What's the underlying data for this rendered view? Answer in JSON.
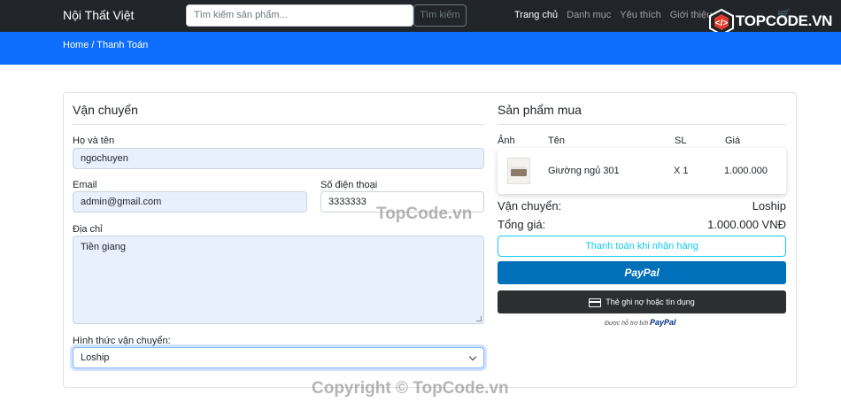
{
  "nav": {
    "brand": "Nội Thất Việt",
    "search_placeholder": "Tìm kiếm sản phẩm...",
    "search_button": "Tìm kiếm",
    "links": [
      "Trang chủ",
      "Danh mục",
      "Yêu thích",
      "Giới thiệu"
    ],
    "logo_text": "TOPCODE.VN"
  },
  "breadcrumb": "Home / Thanh Toán",
  "shipping": {
    "title": "Vận chuyển",
    "name_label": "Họ và tên",
    "name_value": "ngochuyen",
    "email_label": "Email",
    "email_value": "admin@gmail.com",
    "phone_label": "Số điện thoại",
    "phone_value": "3333333",
    "address_label": "Địa chỉ",
    "address_value": "Tiền giang",
    "method_label": "Hình thức vận chuyển:",
    "method_value": "Loship"
  },
  "order": {
    "title": "Sản phẩm mua",
    "headers": [
      "Ảnh",
      "Tên",
      "SL",
      "Giá"
    ],
    "items": [
      {
        "name": "Giường ngủ 301",
        "qty": "X 1",
        "price": "1.000.000"
      }
    ],
    "shipping_label": "Vận chuyển:",
    "shipping_value": "Loship",
    "total_label": "Tổng giá:",
    "total_value": "1.000.000 VNĐ",
    "cod_button": "Thanh toán khi nhận hàng",
    "paypal_button": "PayPal",
    "card_button": "Thẻ ghi nợ hoặc tín dụng",
    "powered_prefix": "Được hỗ trợ bởi",
    "powered_brand": "PayPal"
  },
  "watermarks": [
    "TopCode.vn",
    "Copyright © TopCode.vn"
  ],
  "colors": {
    "navbar": "#212529",
    "banner": "#0d6efd",
    "paypal": "#0070ba",
    "cod": "#0dcaf0"
  }
}
